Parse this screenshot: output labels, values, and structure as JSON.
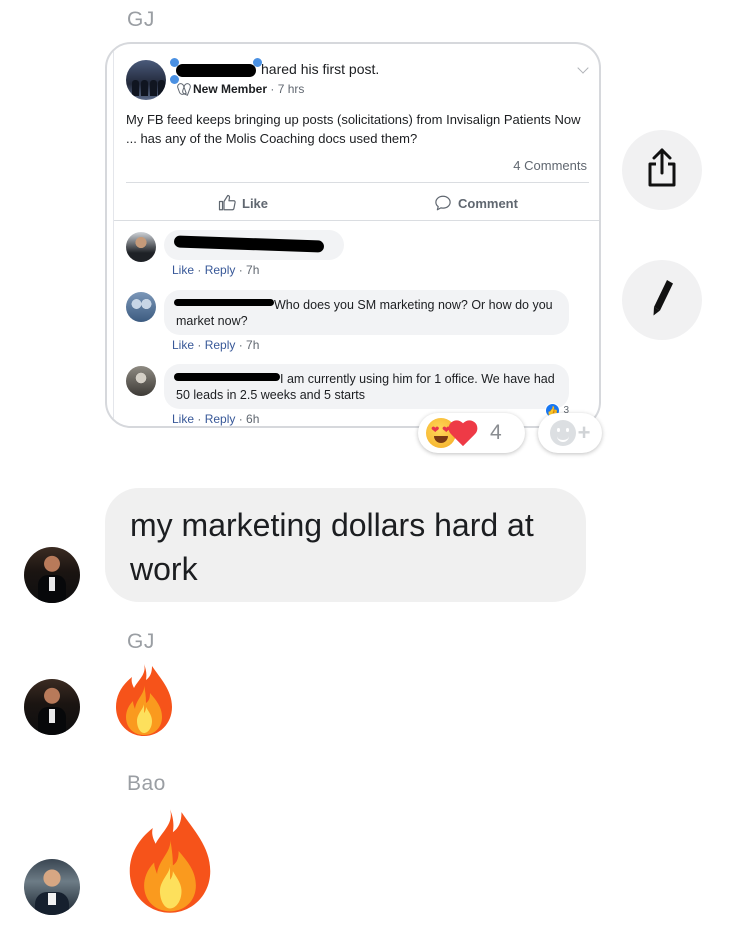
{
  "thread": {
    "sender_gj": "GJ",
    "sender_gj_2": "GJ",
    "sender_bao": "Bao"
  },
  "shared_post": {
    "header_suffix": "hared his first post.",
    "badge_label": "New Member",
    "time": " · 7 hrs",
    "body": "My FB feed keeps bringing up posts (solicitations) from Invisalign Patients Now ... has any of the Molis Coaching docs used them?",
    "comments_count": "4 Comments",
    "like_label": "Like",
    "comment_label": "Comment",
    "comments": [
      {
        "text": "",
        "meta_like": "Like",
        "meta_reply": "Reply",
        "meta_time": " · 7h"
      },
      {
        "text": "Who does you SM marketing now? Or how do you market now?",
        "meta_like": "Like",
        "meta_reply": "Reply",
        "meta_time": " · 7h"
      },
      {
        "text": "I am currently using him for 1 office. We have had 50 leads in 2.5 weeks and 5 starts",
        "meta_like": "Like",
        "meta_reply": "Reply",
        "meta_time": " · 6h",
        "likes": "3"
      }
    ]
  },
  "reactions": {
    "count": "4",
    "emojis": [
      "heart-eyes-emoji",
      "red-heart-emoji"
    ]
  },
  "messages": [
    {
      "sender": "GJ",
      "text": "my marketing dollars hard at work"
    }
  ],
  "icons": {
    "share": "share-icon",
    "edit": "pencil-icon"
  },
  "colors": {
    "bubble_bg": "#f0f0f0",
    "fb_link": "#385898",
    "heart": "#ee3a46"
  }
}
